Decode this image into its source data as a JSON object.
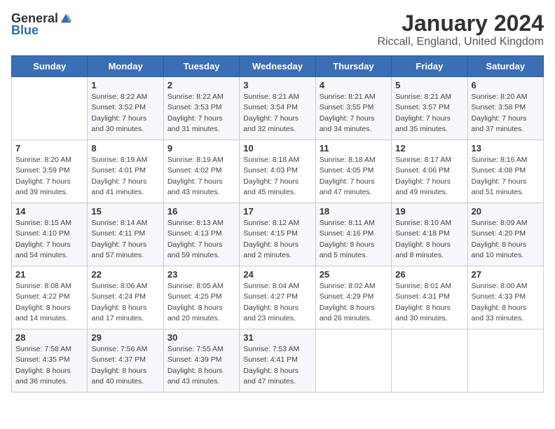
{
  "header": {
    "logo_general": "General",
    "logo_blue": "Blue",
    "title": "January 2024",
    "subtitle": "Riccall, England, United Kingdom"
  },
  "days_of_week": [
    "Sunday",
    "Monday",
    "Tuesday",
    "Wednesday",
    "Thursday",
    "Friday",
    "Saturday"
  ],
  "weeks": [
    [
      {
        "day": "",
        "detail": ""
      },
      {
        "day": "1",
        "detail": "Sunrise: 8:22 AM\nSunset: 3:52 PM\nDaylight: 7 hours\nand 30 minutes."
      },
      {
        "day": "2",
        "detail": "Sunrise: 8:22 AM\nSunset: 3:53 PM\nDaylight: 7 hours\nand 31 minutes."
      },
      {
        "day": "3",
        "detail": "Sunrise: 8:21 AM\nSunset: 3:54 PM\nDaylight: 7 hours\nand 32 minutes."
      },
      {
        "day": "4",
        "detail": "Sunrise: 8:21 AM\nSunset: 3:55 PM\nDaylight: 7 hours\nand 34 minutes."
      },
      {
        "day": "5",
        "detail": "Sunrise: 8:21 AM\nSunset: 3:57 PM\nDaylight: 7 hours\nand 35 minutes."
      },
      {
        "day": "6",
        "detail": "Sunrise: 8:20 AM\nSunset: 3:58 PM\nDaylight: 7 hours\nand 37 minutes."
      }
    ],
    [
      {
        "day": "7",
        "detail": "Sunrise: 8:20 AM\nSunset: 3:59 PM\nDaylight: 7 hours\nand 39 minutes."
      },
      {
        "day": "8",
        "detail": "Sunrise: 8:19 AM\nSunset: 4:01 PM\nDaylight: 7 hours\nand 41 minutes."
      },
      {
        "day": "9",
        "detail": "Sunrise: 8:19 AM\nSunset: 4:02 PM\nDaylight: 7 hours\nand 43 minutes."
      },
      {
        "day": "10",
        "detail": "Sunrise: 8:18 AM\nSunset: 4:03 PM\nDaylight: 7 hours\nand 45 minutes."
      },
      {
        "day": "11",
        "detail": "Sunrise: 8:18 AM\nSunset: 4:05 PM\nDaylight: 7 hours\nand 47 minutes."
      },
      {
        "day": "12",
        "detail": "Sunrise: 8:17 AM\nSunset: 4:06 PM\nDaylight: 7 hours\nand 49 minutes."
      },
      {
        "day": "13",
        "detail": "Sunrise: 8:16 AM\nSunset: 4:08 PM\nDaylight: 7 hours\nand 51 minutes."
      }
    ],
    [
      {
        "day": "14",
        "detail": "Sunrise: 8:15 AM\nSunset: 4:10 PM\nDaylight: 7 hours\nand 54 minutes."
      },
      {
        "day": "15",
        "detail": "Sunrise: 8:14 AM\nSunset: 4:11 PM\nDaylight: 7 hours\nand 57 minutes."
      },
      {
        "day": "16",
        "detail": "Sunrise: 8:13 AM\nSunset: 4:13 PM\nDaylight: 7 hours\nand 59 minutes."
      },
      {
        "day": "17",
        "detail": "Sunrise: 8:12 AM\nSunset: 4:15 PM\nDaylight: 8 hours\nand 2 minutes."
      },
      {
        "day": "18",
        "detail": "Sunrise: 8:11 AM\nSunset: 4:16 PM\nDaylight: 8 hours\nand 5 minutes."
      },
      {
        "day": "19",
        "detail": "Sunrise: 8:10 AM\nSunset: 4:18 PM\nDaylight: 8 hours\nand 8 minutes."
      },
      {
        "day": "20",
        "detail": "Sunrise: 8:09 AM\nSunset: 4:20 PM\nDaylight: 8 hours\nand 10 minutes."
      }
    ],
    [
      {
        "day": "21",
        "detail": "Sunrise: 8:08 AM\nSunset: 4:22 PM\nDaylight: 8 hours\nand 14 minutes."
      },
      {
        "day": "22",
        "detail": "Sunrise: 8:06 AM\nSunset: 4:24 PM\nDaylight: 8 hours\nand 17 minutes."
      },
      {
        "day": "23",
        "detail": "Sunrise: 8:05 AM\nSunset: 4:25 PM\nDaylight: 8 hours\nand 20 minutes."
      },
      {
        "day": "24",
        "detail": "Sunrise: 8:04 AM\nSunset: 4:27 PM\nDaylight: 8 hours\nand 23 minutes."
      },
      {
        "day": "25",
        "detail": "Sunrise: 8:02 AM\nSunset: 4:29 PM\nDaylight: 8 hours\nand 26 minutes."
      },
      {
        "day": "26",
        "detail": "Sunrise: 8:01 AM\nSunset: 4:31 PM\nDaylight: 8 hours\nand 30 minutes."
      },
      {
        "day": "27",
        "detail": "Sunrise: 8:00 AM\nSunset: 4:33 PM\nDaylight: 8 hours\nand 33 minutes."
      }
    ],
    [
      {
        "day": "28",
        "detail": "Sunrise: 7:58 AM\nSunset: 4:35 PM\nDaylight: 8 hours\nand 36 minutes."
      },
      {
        "day": "29",
        "detail": "Sunrise: 7:56 AM\nSunset: 4:37 PM\nDaylight: 8 hours\nand 40 minutes."
      },
      {
        "day": "30",
        "detail": "Sunrise: 7:55 AM\nSunset: 4:39 PM\nDaylight: 8 hours\nand 43 minutes."
      },
      {
        "day": "31",
        "detail": "Sunrise: 7:53 AM\nSunset: 4:41 PM\nDaylight: 8 hours\nand 47 minutes."
      },
      {
        "day": "",
        "detail": ""
      },
      {
        "day": "",
        "detail": ""
      },
      {
        "day": "",
        "detail": ""
      }
    ]
  ]
}
